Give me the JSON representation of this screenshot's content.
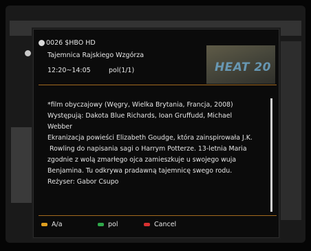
{
  "channel": {
    "name": "0026 $HBO HD"
  },
  "programme": {
    "title": "Tajemnica Rajskiego Wzgórza",
    "time": "12:20~14:05",
    "pages": "pol(1/1)"
  },
  "thumbnail": {
    "logo_text": "HEAT 20"
  },
  "description": [
    "*film obyczajowy (Węgry, Wielka Brytania, Francja, 2008)",
    "Występują: Dakota Blue Richards, Ioan Gruffudd, Michael",
    "Webber",
    "Ekranizacja powieści Elizabeth Goudge, która zainspirowała J.K.",
    " Rowling do napisania sagi o Harrym Potterze. 13-letnia Maria",
    "zgodnie z wolą zmarłego ojca zamieszkuje u swojego wuja",
    "Benjamina. Tu odkrywa pradawną tajemnicę swego rodu.",
    "Reżyser: Gabor Csupo"
  ],
  "buttons": {
    "audio": {
      "label": "A/a",
      "color": "#e0a020"
    },
    "lang": {
      "label": "pol",
      "color": "#2fa84a"
    },
    "cancel": {
      "label": "Cancel",
      "color": "#d83030"
    }
  }
}
